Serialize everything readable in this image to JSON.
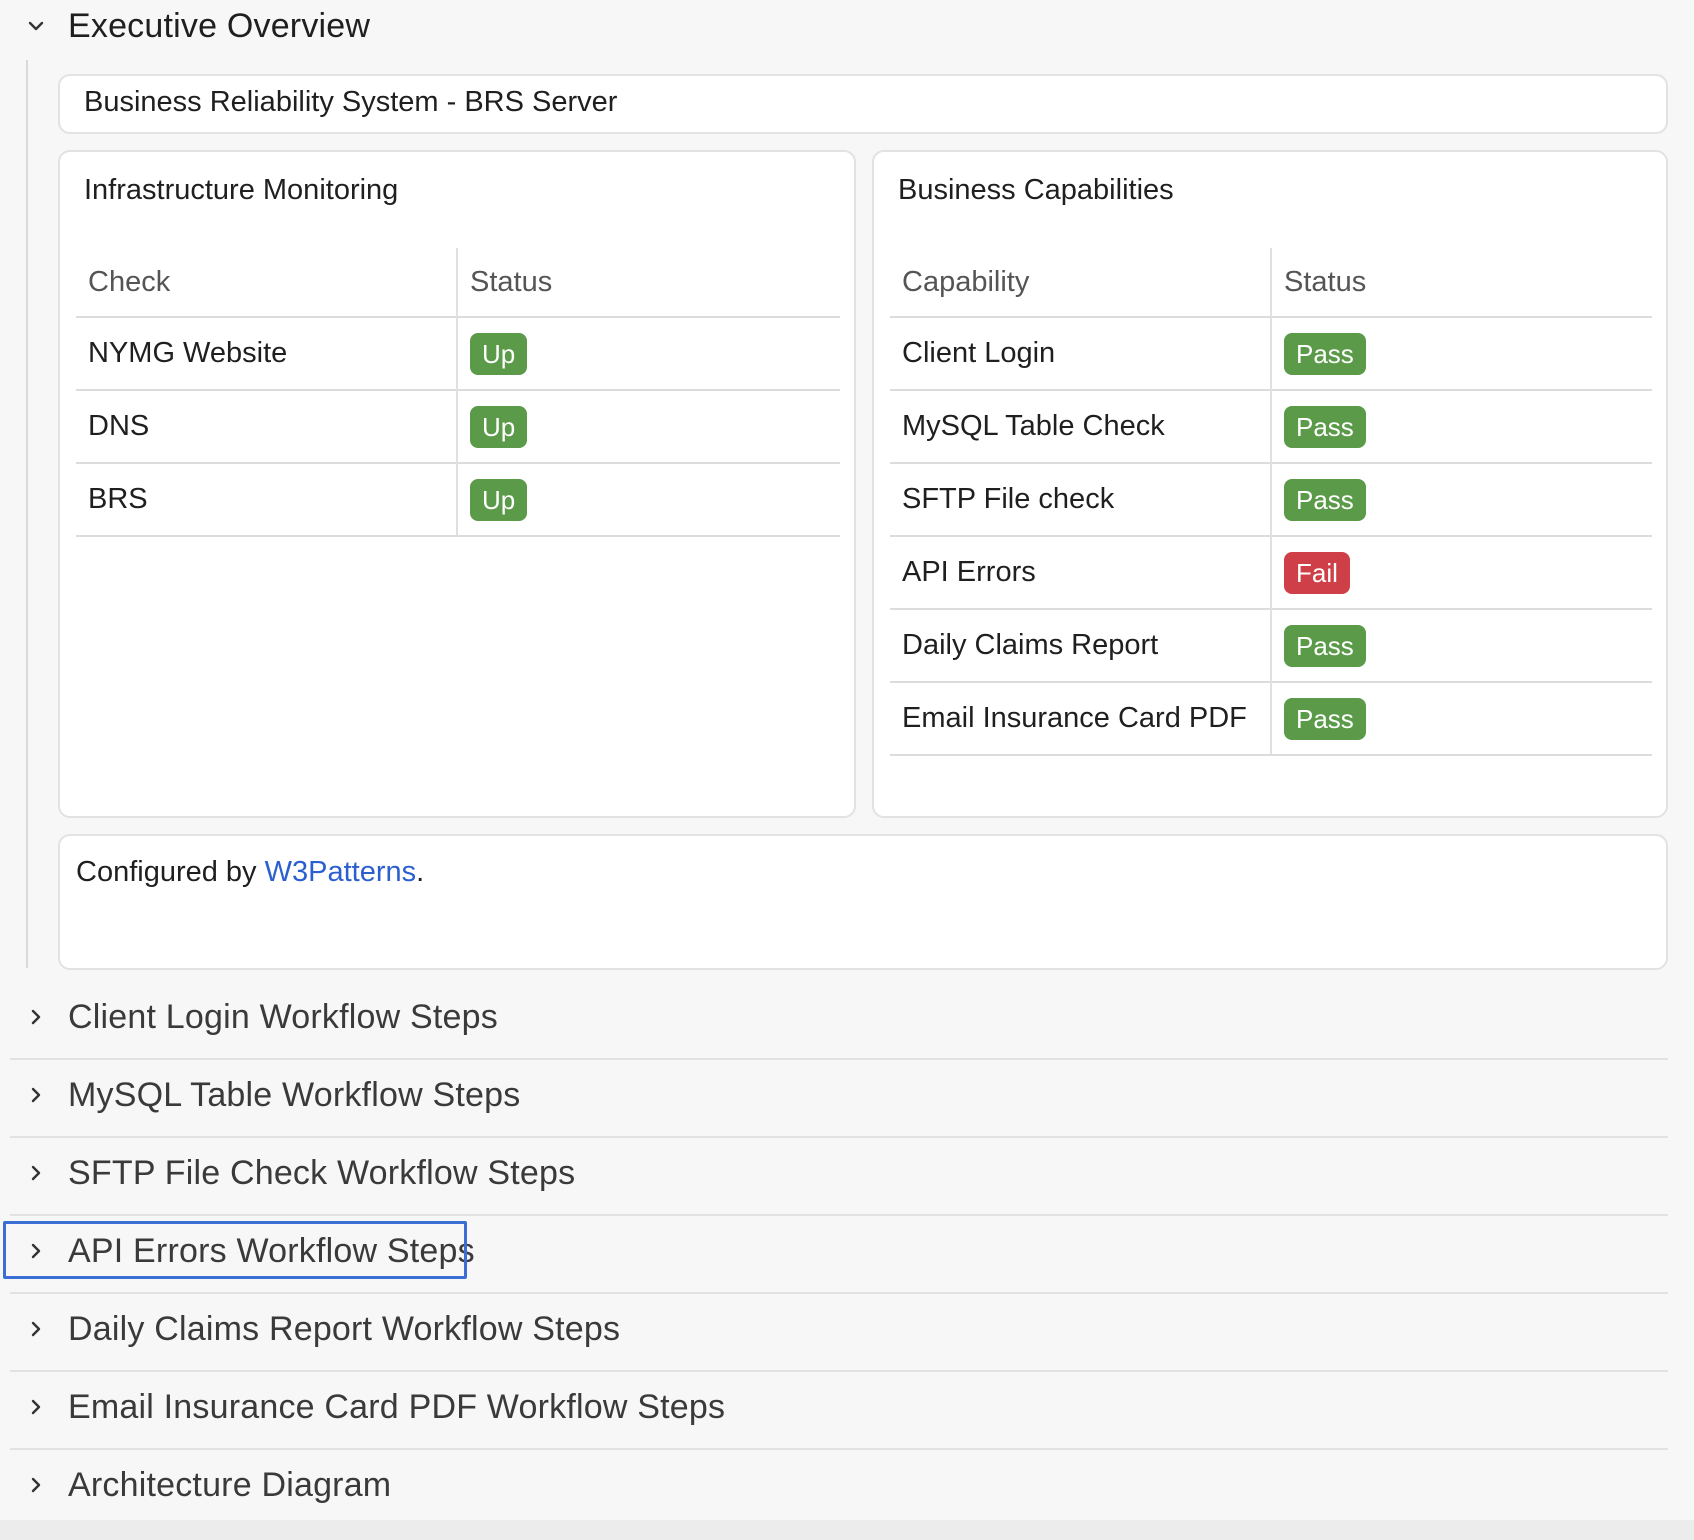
{
  "executive": {
    "title": "Executive Overview",
    "system_title": "Business Reliability System - BRS Server",
    "infra": {
      "title": "Infrastructure Monitoring",
      "headers": [
        "Check",
        "Status"
      ],
      "rows": [
        {
          "name": "NYMG Website",
          "status": "Up"
        },
        {
          "name": "DNS",
          "status": "Up"
        },
        {
          "name": "BRS",
          "status": "Up"
        }
      ]
    },
    "capabilities": {
      "title": "Business Capabilities",
      "headers": [
        "Capability",
        "Status"
      ],
      "rows": [
        {
          "name": "Client Login",
          "status": "Pass"
        },
        {
          "name": "MySQL Table Check",
          "status": "Pass"
        },
        {
          "name": "SFTP File check",
          "status": "Pass"
        },
        {
          "name": "API Errors",
          "status": "Fail"
        },
        {
          "name": "Daily Claims Report",
          "status": "Pass"
        },
        {
          "name": "Email Insurance Card PDF",
          "status": "Pass"
        }
      ]
    },
    "footer": {
      "prefix": "Configured by ",
      "link": "W3Patterns",
      "suffix": "."
    }
  },
  "sections": [
    {
      "title": "Client Login Workflow Steps"
    },
    {
      "title": "MySQL Table Workflow Steps"
    },
    {
      "title": "SFTP File Check Workflow Steps"
    },
    {
      "title": "API Errors Workflow Steps"
    },
    {
      "title": "Daily Claims Report Workflow Steps"
    },
    {
      "title": "Email Insurance Card PDF Workflow Steps"
    },
    {
      "title": "Architecture Diagram"
    }
  ],
  "colors": {
    "pass": "#5a9a48",
    "fail": "#cf3f47",
    "link": "#2b5fd0",
    "focus": "#3b6fd4"
  }
}
